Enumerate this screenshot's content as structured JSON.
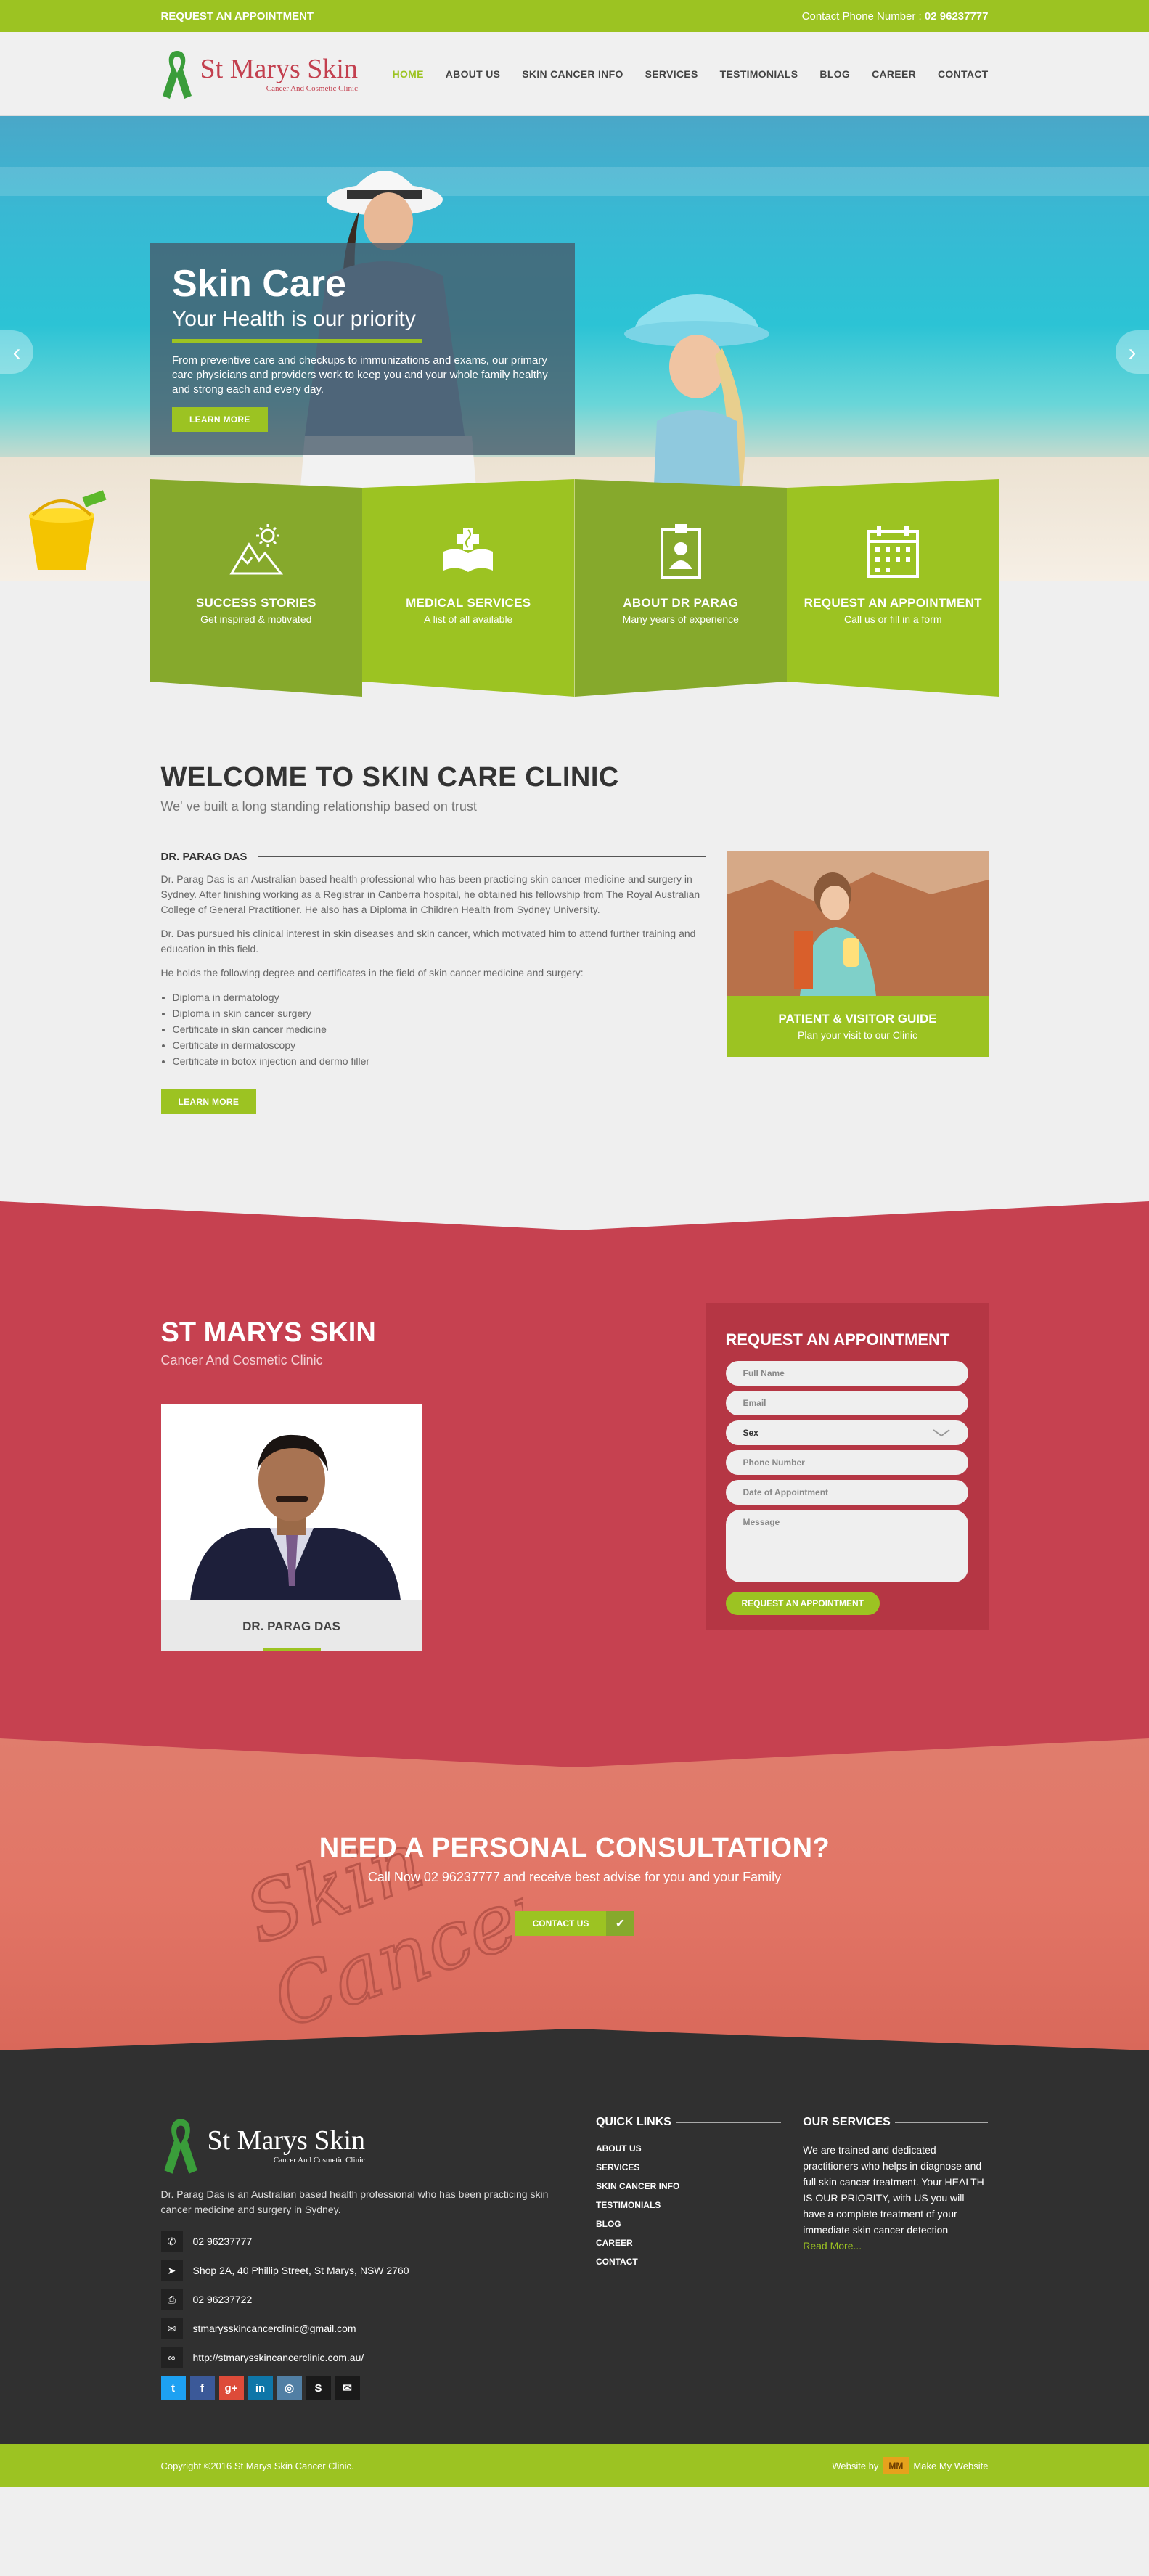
{
  "topbar": {
    "appointment": "REQUEST AN APPOINTMENT",
    "phone_label": "Contact Phone Number :",
    "phone_number": "02 96237777"
  },
  "brand": {
    "name": "St Marys Skin",
    "tagline": "Cancer And Cosmetic Clinic",
    "ribbon_color": "#3a9d3a",
    "name_color": "#c3404f"
  },
  "nav": {
    "items": [
      "HOME",
      "ABOUT US",
      "SKIN CANCER INFO",
      "SERVICES",
      "TESTIMONIALS",
      "BLOG",
      "CAREER",
      "CONTACT"
    ],
    "active": "HOME"
  },
  "hero": {
    "title": "Skin Care",
    "subtitle": "Your Health is our priority",
    "text": "From preventive care and checkups to immunizations and exams, our primary care physicians and providers work to keep you and your whole family healthy and strong each and every day.",
    "button": "LEARN MORE",
    "prev_icon": "chevron-left-icon",
    "next_icon": "chevron-right-icon"
  },
  "tiles": [
    {
      "title": "SUCCESS STORIES",
      "subtitle": "Get inspired & motivated",
      "icon": "mountain-sun-icon"
    },
    {
      "title": "MEDICAL SERVICES",
      "subtitle": "A list of all available",
      "icon": "medical-book-icon"
    },
    {
      "title": "ABOUT DR PARAG",
      "subtitle": "Many years of experience",
      "icon": "id-badge-icon"
    },
    {
      "title": "REQUEST AN APPOINTMENT",
      "subtitle": "Call us or fill in a form",
      "icon": "calendar-icon"
    }
  ],
  "welcome": {
    "title": "WELCOME TO SKIN CARE CLINIC",
    "subtitle": "We' ve built a long standing relationship based on trust",
    "doctor_heading": "DR. PARAG DAS",
    "p1": "Dr. Parag Das is an Australian based health professional who has been practicing skin cancer medicine and surgery in Sydney. After finishing working as a Registrar in Canberra hospital, he obtained his fellowship from The Royal Australian College of General Practitioner. He also has a Diploma in Children Health from Sydney University.",
    "p2": "Dr. Das pursued his clinical interest in skin diseases and skin cancer, which motivated him to attend further training and education in this field.",
    "p3": "He holds the following degree and certificates in the field of skin cancer medicine and surgery:",
    "qualifications": [
      "Diploma in dermatology",
      "Diploma in skin cancer surgery",
      "Certificate in skin cancer medicine",
      "Certificate in dermatoscopy",
      "Certificate in botox injection and dermo filler"
    ],
    "button": "LEARN MORE",
    "guide_title": "PATIENT & VISITOR GUIDE",
    "guide_subtitle": "Plan your visit to our Clinic"
  },
  "clinic": {
    "title": "ST MARYS SKIN",
    "subtitle": "Cancer And Cosmetic Clinic",
    "doctor_name": "DR. PARAG DAS"
  },
  "form": {
    "title": "REQUEST AN APPOINTMENT",
    "full_name": "Full Name",
    "email": "Email",
    "sex": "Sex",
    "phone": "Phone Number",
    "date": "Date of Appointment",
    "message": "Message",
    "submit": "REQUEST AN APPOINTMENT"
  },
  "consult": {
    "title": "NEED A PERSONAL CONSULTATION?",
    "text": "Call Now 02 96237777 and receive best advise for you and your Family",
    "button": "CONTACT US",
    "sand_words": [
      "Skin",
      "Cancer"
    ]
  },
  "footer": {
    "intro": "Dr. Parag Das is an Australian based health professional who has been practicing skin cancer medicine and surgery in Sydney.",
    "contacts": [
      {
        "icon": "phone-icon",
        "text": "02 96237777"
      },
      {
        "icon": "location-arrow-icon",
        "text": "Shop 2A, 40 Phillip Street, St Marys, NSW 2760"
      },
      {
        "icon": "fax-icon",
        "text": "02 96237722"
      },
      {
        "icon": "envelope-icon",
        "text": "stmarysskincancerclinic@gmail.com"
      },
      {
        "icon": "link-icon",
        "text": "http://stmarysskincancerclinic.com.au/"
      }
    ],
    "socials": [
      {
        "icon": "twitter-icon",
        "glyph": "t",
        "color": "#1da1f2"
      },
      {
        "icon": "facebook-icon",
        "glyph": "f",
        "color": "#3b5998"
      },
      {
        "icon": "google-plus-icon",
        "glyph": "g+",
        "color": "#dd4b39"
      },
      {
        "icon": "linkedin-icon",
        "glyph": "in",
        "color": "#0e76a8"
      },
      {
        "icon": "instagram-icon",
        "glyph": "◎",
        "color": "#517fa4"
      },
      {
        "icon": "skype-icon",
        "glyph": "S",
        "color": "#1a1a1a"
      },
      {
        "icon": "mail-icon",
        "glyph": "✉",
        "color": "#1a1a1a"
      }
    ],
    "quick_links_title": "QUICK LINKS",
    "quick_links": [
      "ABOUT US",
      "SERVICES",
      "SKIN CANCER INFO",
      "TESTIMONIALS",
      "BLOG",
      "CAREER",
      "CONTACT"
    ],
    "services_title": "OUR SERVICES",
    "services_text": "We are trained and dedicated practitioners who helps in diagnose and full skin cancer treatment. Your HEALTH IS OUR PRIORITY, with US you will have a complete treatment of your immediate skin cancer detection",
    "read_more": "Read More...",
    "copyright": "Copyright ©2016 St Marys Skin Cancer Clinic.",
    "website_by": "Website by",
    "agency_mark": "MM",
    "agency": "Make My Website"
  },
  "colors": {
    "green": "#9cc322",
    "dark_green": "#86a92c",
    "red": "#c64150",
    "coral": "#e27566",
    "footer": "#303030"
  }
}
